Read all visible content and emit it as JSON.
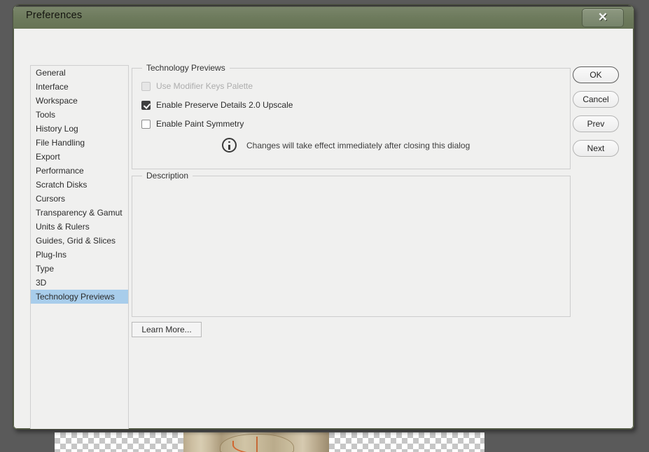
{
  "window": {
    "title": "Preferences",
    "close_label": "✕",
    "title_bar_color": "#6d7a5c",
    "body_color": "#f0f0ef"
  },
  "sidebar": {
    "items": [
      {
        "label": "General",
        "selected": false
      },
      {
        "label": "Interface",
        "selected": false
      },
      {
        "label": "Workspace",
        "selected": false
      },
      {
        "label": "Tools",
        "selected": false
      },
      {
        "label": "History Log",
        "selected": false
      },
      {
        "label": "File Handling",
        "selected": false
      },
      {
        "label": "Export",
        "selected": false
      },
      {
        "label": "Performance",
        "selected": false
      },
      {
        "label": "Scratch Disks",
        "selected": false
      },
      {
        "label": "Cursors",
        "selected": false
      },
      {
        "label": "Transparency & Gamut",
        "selected": false
      },
      {
        "label": "Units & Rulers",
        "selected": false
      },
      {
        "label": "Guides, Grid & Slices",
        "selected": false
      },
      {
        "label": "Plug-Ins",
        "selected": false
      },
      {
        "label": "Type",
        "selected": false
      },
      {
        "label": "3D",
        "selected": false
      },
      {
        "label": "Technology Previews",
        "selected": true
      }
    ],
    "selection_color": "#a8cdeb"
  },
  "tech_previews": {
    "legend": "Technology Previews",
    "checkboxes": [
      {
        "label": "Use Modifier Keys Palette",
        "checked": false,
        "disabled": true
      },
      {
        "label": "Enable Preserve Details 2.0 Upscale",
        "checked": true,
        "disabled": false
      },
      {
        "label": "Enable Paint Symmetry",
        "checked": false,
        "disabled": false
      }
    ],
    "info_icon": "info-circle-icon",
    "info_message": "Changes will take effect immediately after closing this dialog"
  },
  "description": {
    "legend": "Description",
    "body_text": ""
  },
  "learn_more": {
    "label": "Learn More..."
  },
  "buttons": [
    {
      "label": "OK",
      "default": true
    },
    {
      "label": "Cancel",
      "default": false
    },
    {
      "label": "Prev",
      "default": false
    },
    {
      "label": "Next",
      "default": false
    }
  ]
}
